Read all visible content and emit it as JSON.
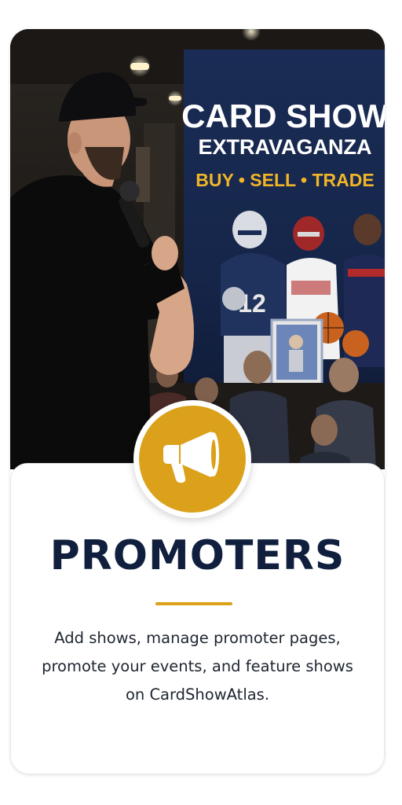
{
  "hero": {
    "banner_line1": "CARD SHOW",
    "banner_line2": "EXTRAVAGANZA",
    "banner_line3": "BUY • SELL • TRADE",
    "jersey_number": "12"
  },
  "badge": {
    "icon": "megaphone-icon",
    "color": "#dba11b"
  },
  "title": "PROMOTERS",
  "description": "Add shows, manage promoter pages, promote your events, and feature shows on CardShowAtlas."
}
